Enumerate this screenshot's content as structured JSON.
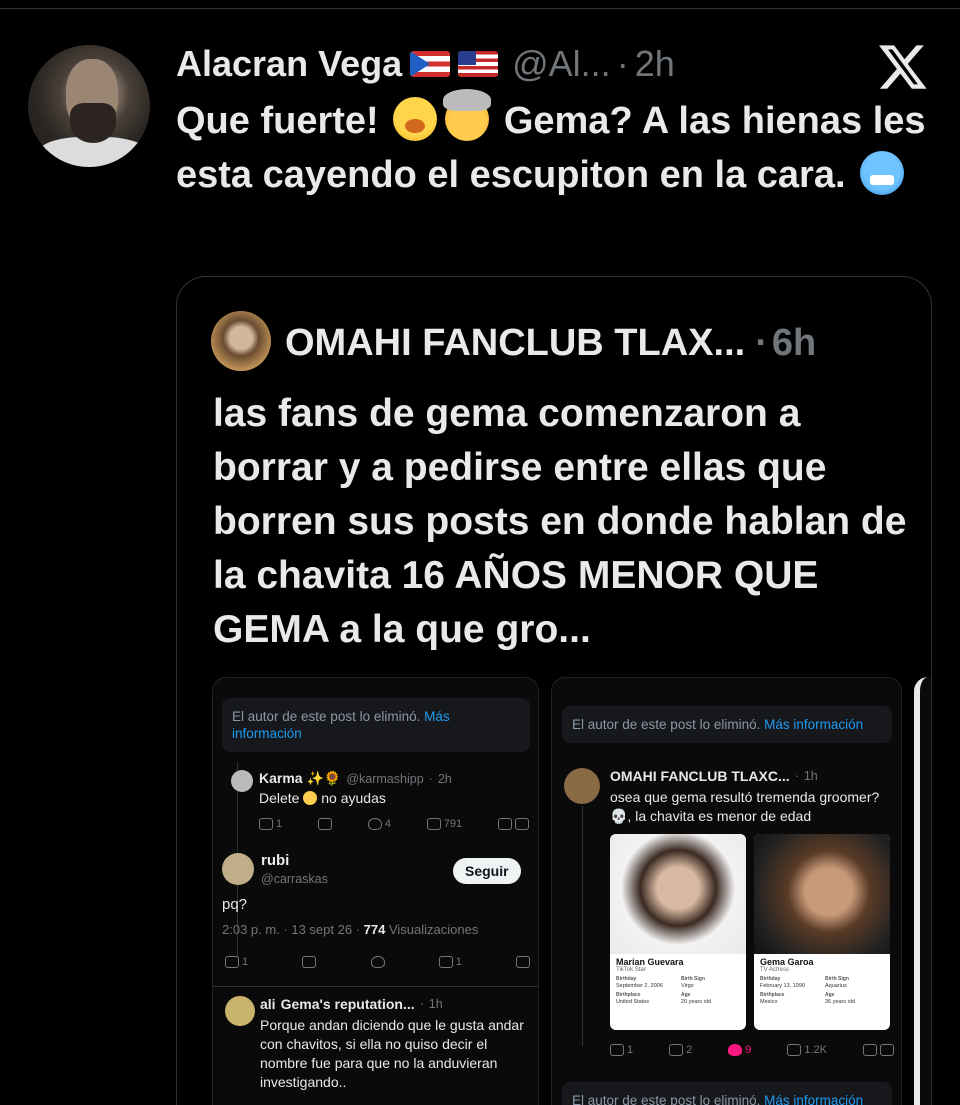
{
  "tweet": {
    "author_name": "Alacran Vega",
    "flags": [
      "flag-puerto-rico",
      "flag-usa"
    ],
    "handle": "@Al...",
    "separator": "·",
    "time": "2h",
    "text_part1": "Que fuerte!",
    "text_part2": "Gema? A las hienas les esta cayendo el escupiton en la cara.",
    "emojis": [
      "yawning-face",
      "exploding-head",
      "cold-face"
    ]
  },
  "quote": {
    "author_name": "OMAHI FANCLUB TLAX...",
    "separator": "·",
    "time": "6h",
    "text": "las fans de gema comenzaron a borrar y a pedirse entre ellas que borren sus posts en donde hablan de la chavita 16 AÑOS MENOR QUE GEMA a la que gro..."
  },
  "shot1": {
    "deleted_text": "El autor de este post lo eliminó.",
    "deleted_more": "Más información",
    "karma": {
      "name": "Karma ✨🌻",
      "handle": "@karmashipp",
      "sep": "·",
      "time": "2h",
      "text": "Delete",
      "text_after": "no ayudas",
      "reply_count": "1",
      "like_count": "4",
      "view_count": "791"
    },
    "rubi": {
      "name": "rubi",
      "handle": "@carraskas",
      "follow": "Seguir",
      "text": "pq?",
      "meta_time": "2:03 p. m. · 13 sept 26 ·",
      "meta_views": "774",
      "meta_views_label": "Visualizaciones",
      "reply_count": "1",
      "bookmark_count": "1"
    },
    "ali": {
      "name": "ali",
      "subtitle": "Gema's reputation...",
      "sep": "·",
      "time": "1h",
      "text": "Porque andan diciendo que le gusta andar con chavitos, si ella no quiso decir el nombre fue para que no la anduvieran investigando.."
    }
  },
  "shot2": {
    "deleted_text": "El autor de este post lo eliminó.",
    "deleted_more": "Más información",
    "post": {
      "name": "OMAHI FANCLUB TLAXC...",
      "sep": "·",
      "time": "1h",
      "text": "osea que gema resultó tremenda groomer? 💀, la chavita es menor de edad"
    },
    "card1": {
      "name": "Marian Guevara",
      "role": "TikTok Star",
      "birthday_label": "Birthday",
      "birthday": "September 2, 2006",
      "sign_label": "Birth Sign",
      "sign": "Virgo",
      "place_label": "Birthplace",
      "place": "United States",
      "age_label": "Age",
      "age": "20 years old"
    },
    "card2": {
      "name": "Gema Garoa",
      "role": "TV Actress",
      "birthday_label": "Birthday",
      "birthday": "February 13, 1990",
      "sign_label": "Birth Sign",
      "sign": "Aquarius",
      "place_label": "Birthplace",
      "place": "Mexico",
      "age_label": "Age",
      "age": "36 years old"
    },
    "reply_count": "1",
    "retweet_count": "2",
    "like_count": "9",
    "view_count": "1.2K",
    "deleted_text_2": "El autor de este post lo eliminó.",
    "deleted_more_2": "Más información"
  },
  "colors": {
    "background": "#000000",
    "text": "#e7e9ea",
    "muted": "#71767b",
    "link": "#1d9bf0",
    "like": "#f91880"
  }
}
